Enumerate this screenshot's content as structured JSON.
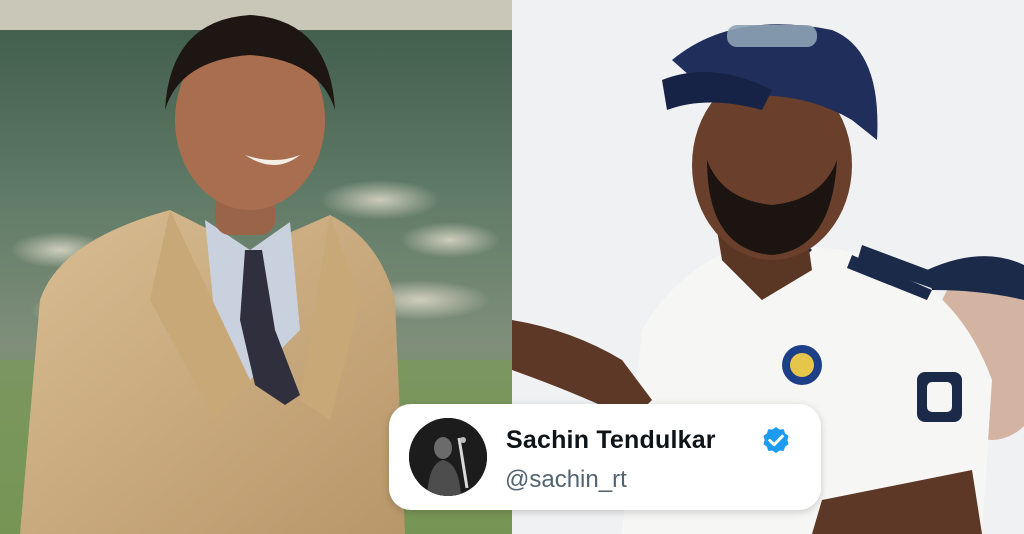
{
  "tweet": {
    "name": "Sachin Tendulkar",
    "handle": "@sachin_rt",
    "verified": true,
    "verified_color": "#1d9bf0"
  },
  "photos": {
    "left": {
      "subject": "man-in-beige-suit"
    },
    "right": {
      "subject": "cricketer-in-white-test-jersey"
    }
  }
}
